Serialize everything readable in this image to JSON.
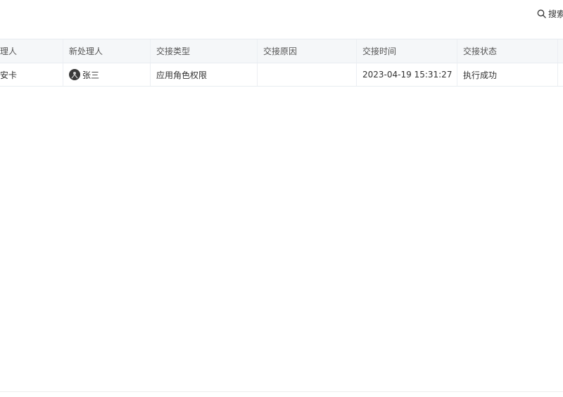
{
  "toolbar": {
    "search_label": "搜索"
  },
  "table": {
    "headers": [
      "理人",
      "新处理人",
      "交接类型",
      "交接原因",
      "交接时间",
      "交接状态"
    ],
    "rows": [
      {
        "prev_handler": "安卡",
        "new_handler": "张三",
        "type": "应用角色权限",
        "reason": "",
        "time": "2023-04-19 15:31:27",
        "status": "执行成功"
      }
    ]
  }
}
